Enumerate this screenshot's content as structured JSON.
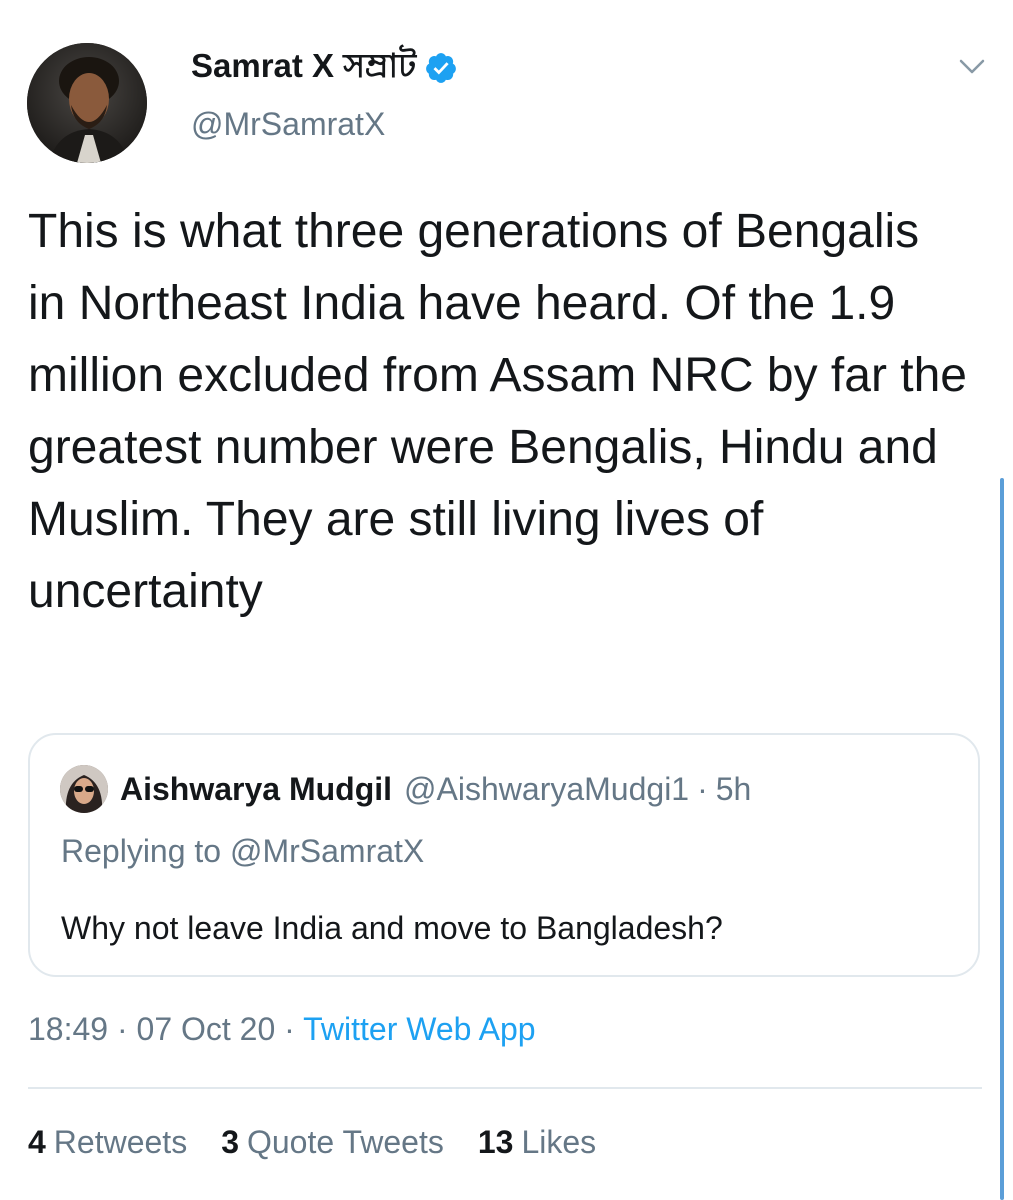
{
  "tweet": {
    "author": {
      "name": "Samrat X সম্রাট",
      "handle": "@MrSamratX",
      "verified": true
    },
    "text": "This is what three generations of Bengalis in Northeast India have heard. Of the 1.9 million excluded from Assam NRC by far the greatest number were Bengalis, Hindu and Muslim. They are still living lives of uncertainty",
    "timestamp": "18:49 · 07 Oct 20",
    "meta_separator": " · ",
    "source": "Twitter Web App",
    "stats": {
      "retweets_count": "4",
      "retweets_label": "Retweets",
      "quote_tweets_count": "3",
      "quote_tweets_label": "Quote Tweets",
      "likes_count": "13",
      "likes_label": "Likes"
    }
  },
  "quoted_tweet": {
    "author_name": "Aishwarya Mudgil",
    "author_handle": "@AishwaryaMudgi1",
    "separator": "·",
    "time": "5h",
    "replying_to": "Replying to @MrSamratX",
    "text": "Why not leave India and move to Bangladesh?"
  },
  "colors": {
    "accent": "#1da1f2",
    "text_primary": "#14171a",
    "text_secondary": "#657786",
    "border": "#e1e8ed"
  },
  "icons": {
    "verified": "verified-badge-icon",
    "more": "chevron-down-icon"
  }
}
